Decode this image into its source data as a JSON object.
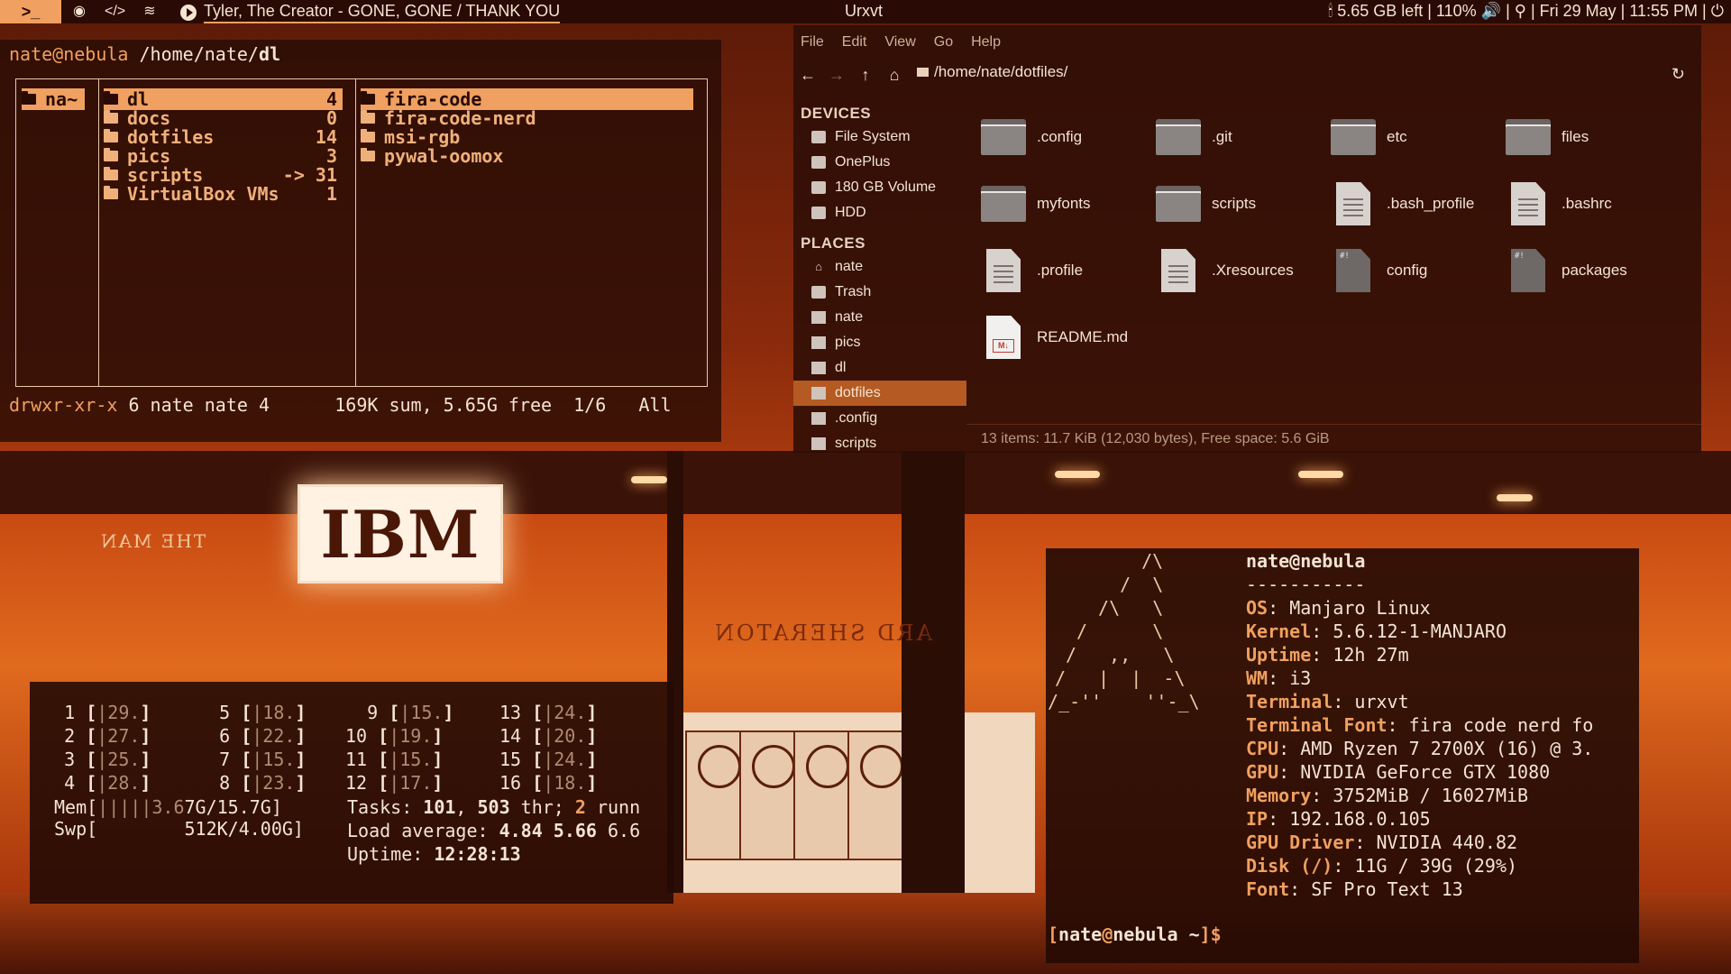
{
  "topbar": {
    "terminal_icon": ">_",
    "icons": [
      "chrome-icon",
      "code-icon",
      "spotify-icon"
    ],
    "now_playing": "Tyler, The Creator - GONE, GONE / THANK YOU",
    "window_title": "Urxvt",
    "status": "5.65 GB left | 110%",
    "datetime": "Fri 29 May | 11:55 PM |"
  },
  "ranger": {
    "user": "nate@nebula",
    "path_prefix": "/home/nate/",
    "path_dir": "dl",
    "parent": {
      "name": "na~"
    },
    "current": [
      {
        "name": "dl",
        "count": "4",
        "selected": true
      },
      {
        "name": "docs",
        "count": "0"
      },
      {
        "name": "dotfiles",
        "count": "14"
      },
      {
        "name": "pics",
        "count": "3"
      },
      {
        "name": "scripts",
        "count": "-> 31"
      },
      {
        "name": "VirtualBox VMs",
        "count": "1"
      }
    ],
    "preview": [
      {
        "name": "fira-code",
        "selected": true
      },
      {
        "name": "fira-code-nerd"
      },
      {
        "name": "msi-rgb"
      },
      {
        "name": "pywal-oomox"
      }
    ],
    "status_perm": "drwxr-xr-x",
    "status_rest": " 6 nate nate 4      169K sum, 5.65G free  1/6   All"
  },
  "filemanager": {
    "menu": [
      "File",
      "Edit",
      "View",
      "Go",
      "Help"
    ],
    "path": "/home/nate/dotfiles/",
    "devices_heading": "DEVICES",
    "devices": [
      "File System",
      "OnePlus",
      "180 GB Volume",
      "HDD"
    ],
    "places_heading": "PLACES",
    "places": [
      "nate",
      "Trash",
      "nate",
      "pics",
      "dl",
      "dotfiles",
      ".config",
      "scripts"
    ],
    "selected_place": "dotfiles",
    "files": [
      {
        "name": ".config",
        "kind": "folder"
      },
      {
        "name": ".git",
        "kind": "folder"
      },
      {
        "name": "etc",
        "kind": "folder"
      },
      {
        "name": "files",
        "kind": "folder"
      },
      {
        "name": "myfonts",
        "kind": "folder"
      },
      {
        "name": "scripts",
        "kind": "folder"
      },
      {
        "name": ".bash_profile",
        "kind": "text"
      },
      {
        "name": ".bashrc",
        "kind": "text"
      },
      {
        "name": ".profile",
        "kind": "text"
      },
      {
        "name": ".Xresources",
        "kind": "text"
      },
      {
        "name": "config",
        "kind": "exec"
      },
      {
        "name": "packages",
        "kind": "exec"
      },
      {
        "name": "README.md",
        "kind": "markdown"
      }
    ],
    "status": "13 items: 11.7 KiB (12,030 bytes), Free space: 5.6 GiB"
  },
  "htop": {
    "cpus": [
      {
        "n": "1",
        "bar": "|",
        "val": "29."
      },
      {
        "n": "2",
        "bar": "|",
        "val": "27."
      },
      {
        "n": "3",
        "bar": "|",
        "val": "25."
      },
      {
        "n": "4",
        "bar": "|",
        "val": "28."
      },
      {
        "n": "5",
        "bar": "|",
        "val": "18."
      },
      {
        "n": "6",
        "bar": "|",
        "val": "22."
      },
      {
        "n": "7",
        "bar": "|",
        "val": "15."
      },
      {
        "n": "8",
        "bar": "|",
        "val": "23."
      },
      {
        "n": "9",
        "bar": "|",
        "val": "15."
      },
      {
        "n": "10",
        "bar": "|",
        "val": "19."
      },
      {
        "n": "11",
        "bar": "|",
        "val": "15."
      },
      {
        "n": "12",
        "bar": "|",
        "val": "17."
      },
      {
        "n": "13",
        "bar": "|",
        "val": "24."
      },
      {
        "n": "14",
        "bar": "|",
        "val": "20."
      },
      {
        "n": "15",
        "bar": "|",
        "val": "24."
      },
      {
        "n": "16",
        "bar": "|",
        "val": "18."
      }
    ],
    "mem_label": "Mem[",
    "mem_bar": "|||||3.6",
    "mem_val": "7G/15.7G]",
    "swp_label": "Swp[",
    "swp_val": "512K/4.00G]",
    "tasks_label": "Tasks: ",
    "tasks": "101",
    "thr": "503",
    "thr_label": " thr; ",
    "running": "2",
    "running_label": " runn",
    "load_label": "Load average: ",
    "load1": "4.84",
    "load5": "5.66",
    "load15": "6.6",
    "uptime_label": "Uptime: ",
    "uptime": "12:28:13"
  },
  "neofetch": {
    "user": "nate",
    "host": "nebula",
    "separator": "-----------",
    "lines": [
      {
        "k": "OS",
        "v": "Manjaro Linux"
      },
      {
        "k": "Kernel",
        "v": "5.6.12-1-MANJARO"
      },
      {
        "k": "Uptime",
        "v": "12h 27m"
      },
      {
        "k": "WM",
        "v": "i3"
      },
      {
        "k": "Terminal",
        "v": "urxvt"
      },
      {
        "k": "Terminal Font",
        "v": "fira code nerd fo"
      },
      {
        "k": "CPU",
        "v": "AMD Ryzen 7 2700X (16) @ 3."
      },
      {
        "k": "GPU",
        "v": "NVIDIA GeForce GTX 1080"
      },
      {
        "k": "Memory",
        "v": "3752MiB / 16027MiB"
      },
      {
        "k": "IP",
        "v": "192.168.0.105"
      },
      {
        "k": "GPU Driver",
        "v": "NVIDIA 440.82"
      },
      {
        "k": "Disk (/)",
        "v": "11G / 39G (29%)"
      },
      {
        "k": "Font",
        "v": "SF Pro Text 13"
      }
    ],
    "prompt_user": "nate",
    "prompt_host": "nebula",
    "prompt_dir": "~",
    "ascii": [
      "   /\\",
      "  /  \\",
      " /\\   \\",
      "/      \\",
      "/   ,,   \\",
      "/   |  |  -\\",
      "/_-''    ''-_\\"
    ]
  },
  "wallpaper": {
    "sign": "IBM",
    "reflection_1": "ARD SHERATON",
    "reflection_2": "THE MAN"
  }
}
